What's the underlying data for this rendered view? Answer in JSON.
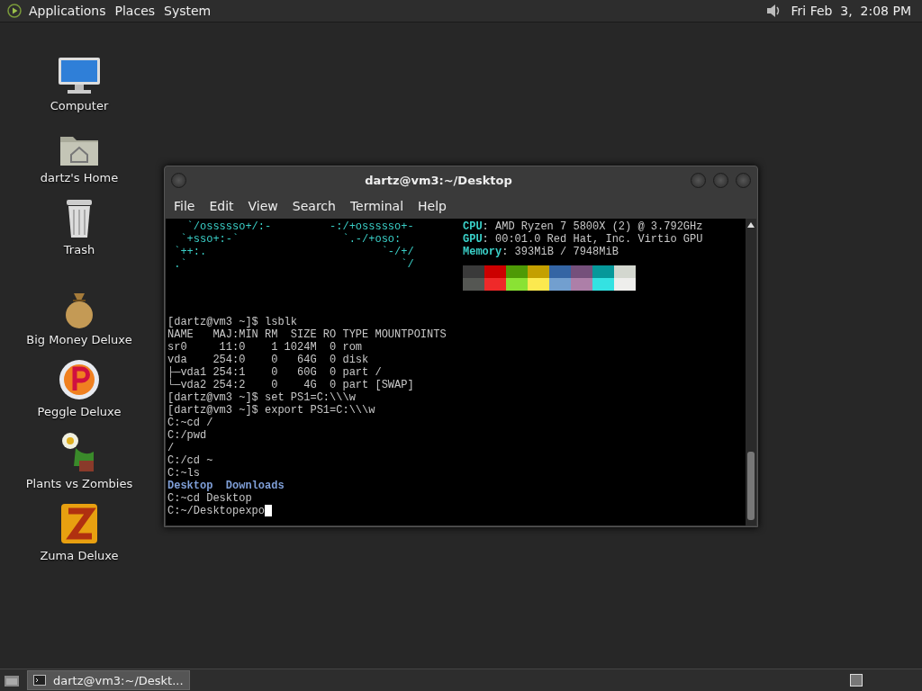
{
  "top_panel": {
    "menus": [
      "Applications",
      "Places",
      "System"
    ],
    "clock": "Fri Feb  3,  2:08 PM"
  },
  "desktop_icons": [
    {
      "kind": "computer",
      "label": "Computer"
    },
    {
      "kind": "home",
      "label": "dartz's Home"
    },
    {
      "kind": "trash",
      "label": "Trash"
    },
    {
      "kind": "money",
      "label": "Big Money Deluxe"
    },
    {
      "kind": "peggle",
      "label": "Peggle Deluxe"
    },
    {
      "kind": "plants",
      "label": "Plants vs Zombies"
    },
    {
      "kind": "zuma",
      "label": "Zuma Deluxe"
    }
  ],
  "window": {
    "title": "dartz@vm3:~/Desktop",
    "menu": [
      "File",
      "Edit",
      "View",
      "Search",
      "Terminal",
      "Help"
    ]
  },
  "terminal": {
    "neofetch": [
      {
        "art": "   `/ossssso+/:-         -:/+ossssso+-",
        "label": "CPU",
        "value": ": AMD Ryzen 7 5800X (2) @ 3.792GHz"
      },
      {
        "art": "  `+sso+:-`                `.-/+oso:",
        "label": "GPU",
        "value": ": 00:01.0 Red Hat, Inc. Virtio GPU"
      },
      {
        "art": " `++:.                           `-/+/",
        "label": "Memory",
        "value": ": 393MiB / 7948MiB"
      },
      {
        "art": " .`                                 `/"
      }
    ],
    "palette": [
      {
        "color": "#3a3a3a"
      },
      {
        "color": "#cc0000"
      },
      {
        "color": "#4e9a06"
      },
      {
        "color": "#c4a000"
      },
      {
        "color": "#3465a4"
      },
      {
        "color": "#75507b"
      },
      {
        "color": "#06989a"
      },
      {
        "color": "#d3d7cf"
      },
      {
        "color": "#555753"
      },
      {
        "color": "#ef2929"
      },
      {
        "color": "#8ae234"
      },
      {
        "color": "#fce94f"
      },
      {
        "color": "#729fcf"
      },
      {
        "color": "#ad7fa8"
      },
      {
        "color": "#34e2e2"
      },
      {
        "color": "#eeeeec"
      }
    ],
    "lines": [
      {
        "kind": "text",
        "text": "[dartz@vm3 ~]$ lsblk"
      },
      {
        "kind": "text",
        "text": "NAME   MAJ:MIN RM  SIZE RO TYPE MOUNTPOINTS"
      },
      {
        "kind": "text",
        "text": "sr0     11:0    1 1024M  0 rom"
      },
      {
        "kind": "text",
        "text": "vda    254:0    0   64G  0 disk"
      },
      {
        "kind": "text",
        "text": "├─vda1 254:1    0   60G  0 part /"
      },
      {
        "kind": "text",
        "text": "└─vda2 254:2    0    4G  0 part [SWAP]"
      },
      {
        "kind": "text",
        "text": "[dartz@vm3 ~]$ set PS1=C:\\\\\\w"
      },
      {
        "kind": "text",
        "text": "[dartz@vm3 ~]$ export PS1=C:\\\\\\w"
      },
      {
        "kind": "text",
        "text": "C:~cd /"
      },
      {
        "kind": "text",
        "text": "C:/pwd"
      },
      {
        "kind": "text",
        "text": "/"
      },
      {
        "kind": "text",
        "text": "C:/cd ~"
      },
      {
        "kind": "text",
        "text": "C:~ls"
      },
      {
        "kind": "dirs",
        "text": "Desktop  Downloads"
      },
      {
        "kind": "text",
        "text": "C:~cd Desktop"
      },
      {
        "kind": "prompt",
        "text": "C:~/Desktopexpo"
      }
    ]
  },
  "taskbar": {
    "tasks": [
      {
        "label": "dartz@vm3:~/Deskt...",
        "selected": true
      }
    ]
  }
}
